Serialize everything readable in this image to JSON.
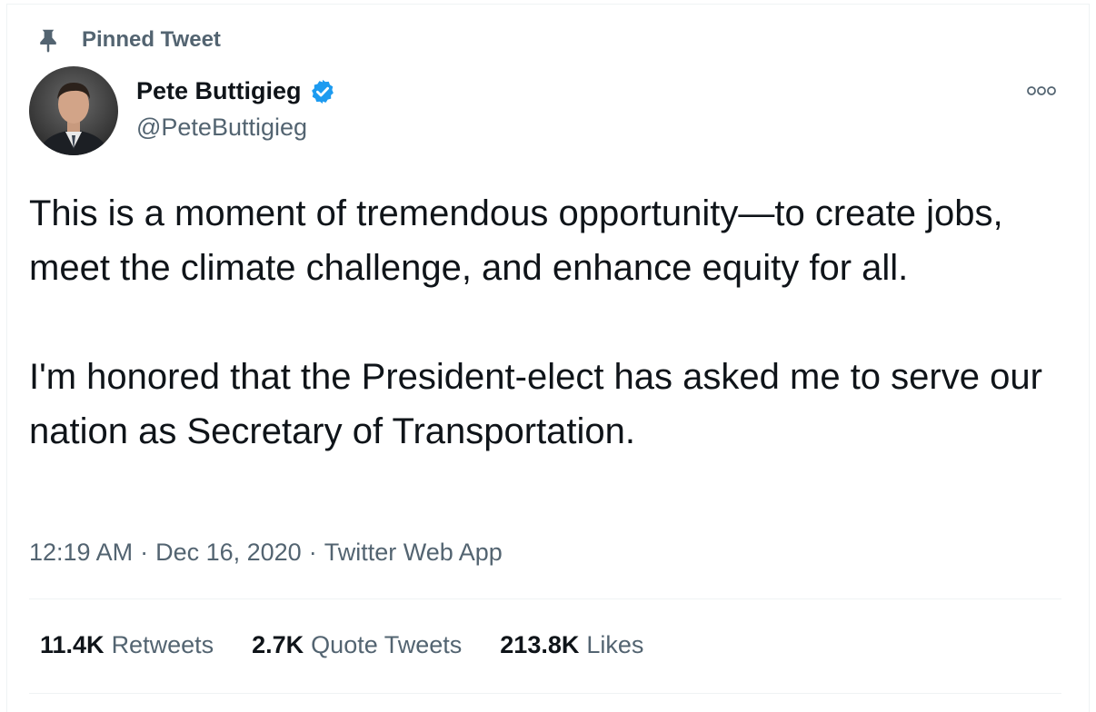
{
  "pinned": {
    "label": "Pinned Tweet",
    "icon": "pin-icon"
  },
  "author": {
    "name": "Pete Buttigieg",
    "handle": "@PeteButtigieg",
    "verified": true,
    "verified_color": "#1d9bf0"
  },
  "tweet": {
    "text": "This is a moment of tremendous opportunity—to create jobs, meet the climate challenge, and enhance equity for all.\n\nI'm honored that the President-elect has asked me to serve our nation as Secretary of Transportation."
  },
  "meta": {
    "time": "12:19 AM",
    "date": "Dec 16, 2020",
    "source": "Twitter Web App",
    "separator": "·"
  },
  "stats": [
    {
      "count": "11.4K",
      "label": "Retweets"
    },
    {
      "count": "2.7K",
      "label": "Quote Tweets"
    },
    {
      "count": "213.8K",
      "label": "Likes"
    }
  ],
  "colors": {
    "text_primary": "#0f1419",
    "text_secondary": "#536471",
    "divider": "#eff3f4"
  }
}
